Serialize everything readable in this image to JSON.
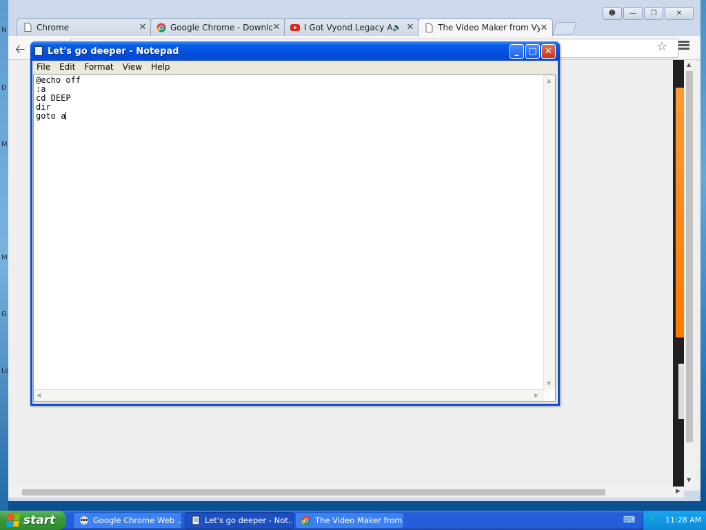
{
  "browser": {
    "tabs": [
      {
        "label": "Chrome",
        "icon": "page-icon"
      },
      {
        "label": "Google Chrome - Download t",
        "icon": "chrome-logo-icon"
      },
      {
        "label": "I Got Vyond Legacy ACS",
        "icon": "youtube-icon",
        "muted_icon": "speaker-icon"
      },
      {
        "label": "The Video Maker from Vyond",
        "icon": "page-icon",
        "active": true
      }
    ],
    "window_controls": [
      "user-icon",
      "minimize-icon",
      "restore-icon",
      "close-icon"
    ],
    "colors": {
      "accent": "#ff8a00",
      "chrome_frame": "#cdd9eb"
    }
  },
  "desktop": {
    "letters": [
      "N",
      "D",
      "M",
      "M",
      "G",
      "Le"
    ]
  },
  "notepad": {
    "title": "Let's go deeper - Notepad",
    "menu": [
      "File",
      "Edit",
      "Format",
      "View",
      "Help"
    ],
    "content": "@echo off\n:a\ncd DEEP\ndir\ngoto a"
  },
  "taskbar": {
    "start_label": "start",
    "tasks": [
      {
        "label": "Google Chrome Web ...",
        "icon": "raccoon-icon"
      },
      {
        "label": "Let's go deeper - Not...",
        "icon": "notepad-icon",
        "active": true
      },
      {
        "label": "The Video Maker from...",
        "icon": "chrome-logo-icon"
      }
    ],
    "clock": "11:28 AM"
  }
}
